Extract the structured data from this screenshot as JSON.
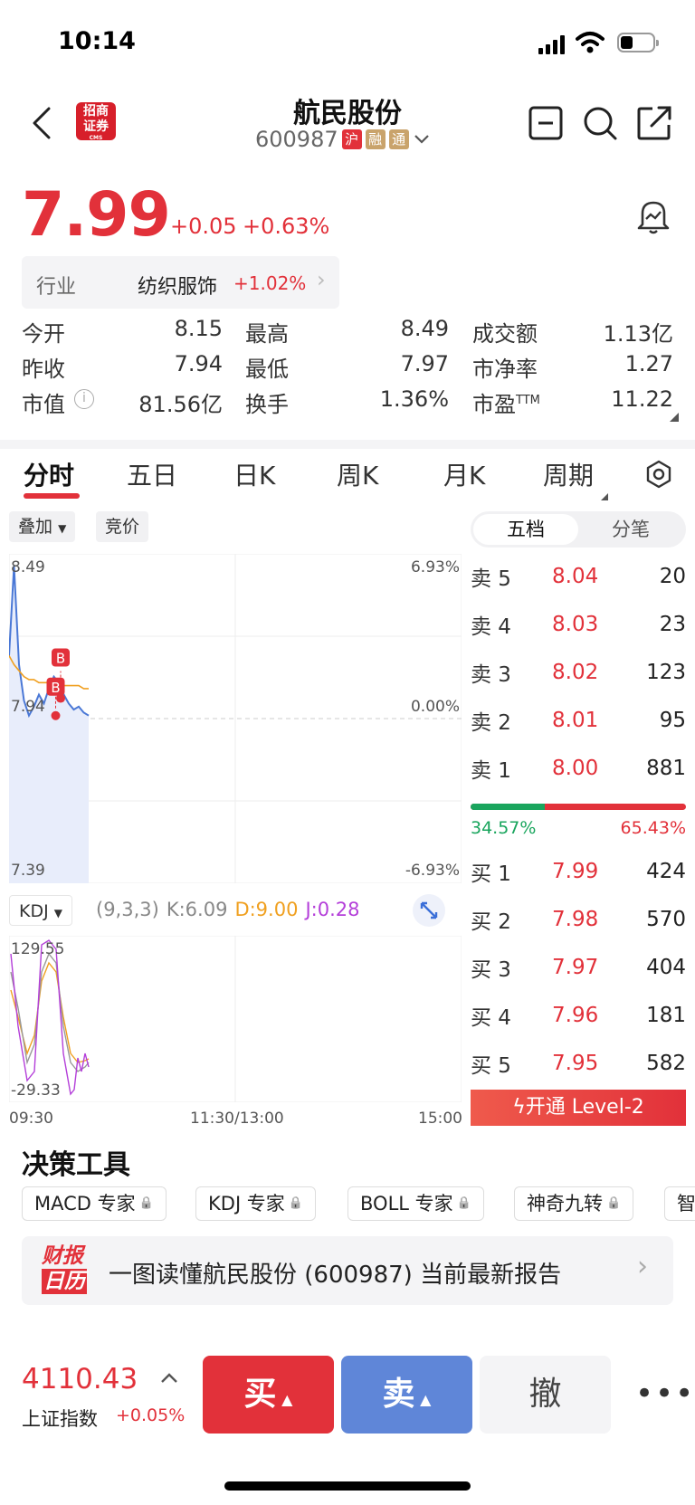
{
  "status_bar": {
    "time": "10:14"
  },
  "header": {
    "title": "航民股份",
    "code": "600987",
    "tags": [
      "沪",
      "融",
      "通"
    ],
    "broker_logo": "招商证券",
    "broker_logo_sub": "CMS"
  },
  "quote": {
    "price": "7.99",
    "change": "+0.05",
    "change_pct": "+0.63%",
    "industry_label": "行业",
    "industry_name": "纺织服饰",
    "industry_change": "+1.02%"
  },
  "stats": [
    {
      "label": "今开",
      "value": "8.15",
      "color": "red"
    },
    {
      "label": "最高",
      "value": "8.49",
      "color": "red"
    },
    {
      "label": "成交额",
      "value": "1.13亿",
      "color": "black"
    },
    {
      "label": "昨收",
      "value": "7.94",
      "color": "black"
    },
    {
      "label": "最低",
      "value": "7.97",
      "color": "red"
    },
    {
      "label": "市净率",
      "value": "1.27",
      "color": "black"
    },
    {
      "label": "市值",
      "value": "81.56亿",
      "color": "black"
    },
    {
      "label": "换手",
      "value": "1.36%",
      "color": "black"
    },
    {
      "label": "市盈",
      "value": "11.22",
      "color": "black",
      "sup": "TTM"
    }
  ],
  "tabs": [
    "分时",
    "五日",
    "日K",
    "周K",
    "月K",
    "周期"
  ],
  "chart_controls": {
    "overlay": "叠加",
    "auction": "竞价",
    "indicator": "KDJ",
    "kdj_params": "(9,3,3)",
    "k": "K:6.09",
    "d": "D:9.00",
    "j": "J:0.28"
  },
  "chart_data": {
    "type": "line",
    "price_axis": {
      "max": "8.49",
      "mid": "7.94",
      "min": "7.39"
    },
    "pct_axis": {
      "max": "6.93%",
      "mid": "0.00%",
      "min": "-6.93%"
    },
    "kdj_axis": {
      "max": "129.55",
      "min": "-29.33"
    },
    "time_labels": [
      "09:30",
      "11:30/13:00",
      "15:00"
    ],
    "ylim": [
      7.39,
      8.49
    ],
    "prev_close": 7.94,
    "series": [
      {
        "values": [
          8.15,
          8.45,
          8.12,
          8.0,
          7.95,
          7.98,
          8.02,
          7.99,
          8.04,
          8.08,
          8.06,
          8.02,
          7.99,
          7.97,
          7.98,
          7.96,
          7.95
        ]
      },
      {
        "values": [
          8.15,
          8.12,
          8.1,
          8.08,
          8.07,
          8.07,
          8.06,
          8.06,
          8.06,
          8.06,
          8.05,
          8.05,
          8.05,
          8.05,
          8.05,
          8.04,
          8.04
        ]
      }
    ],
    "markers": [
      "B",
      "B"
    ]
  },
  "orderbook": {
    "tabs": [
      "五档",
      "分笔"
    ],
    "asks": [
      {
        "label": "卖 5",
        "price": "8.04",
        "qty": "20"
      },
      {
        "label": "卖 4",
        "price": "8.03",
        "qty": "23"
      },
      {
        "label": "卖 3",
        "price": "8.02",
        "qty": "123"
      },
      {
        "label": "卖 2",
        "price": "8.01",
        "qty": "95"
      },
      {
        "label": "卖 1",
        "price": "8.00",
        "qty": "881"
      }
    ],
    "buy_ratio": "34.57%",
    "sell_ratio": "65.43%",
    "buy_fraction": 0.3457,
    "bids": [
      {
        "label": "买 1",
        "price": "7.99",
        "qty": "424"
      },
      {
        "label": "买 2",
        "price": "7.98",
        "qty": "570"
      },
      {
        "label": "买 3",
        "price": "7.97",
        "qty": "404"
      },
      {
        "label": "买 4",
        "price": "7.96",
        "qty": "181"
      },
      {
        "label": "买 5",
        "price": "7.95",
        "qty": "582"
      }
    ],
    "level2_label": "开通 Level-2"
  },
  "tools": {
    "title": "决策工具",
    "items": [
      "MACD 专家",
      "KDJ 专家",
      "BOLL 专家",
      "神奇九转",
      "智"
    ]
  },
  "report": {
    "badge_top": "财报",
    "badge_bottom": "日历",
    "text": "一图读懂航民股份 (600987) 当前最新报告"
  },
  "bottom": {
    "index_value": "4110.43",
    "index_name": "上证指数",
    "index_change": "+0.05%",
    "buy": "买",
    "sell": "卖",
    "cancel": "撤"
  }
}
